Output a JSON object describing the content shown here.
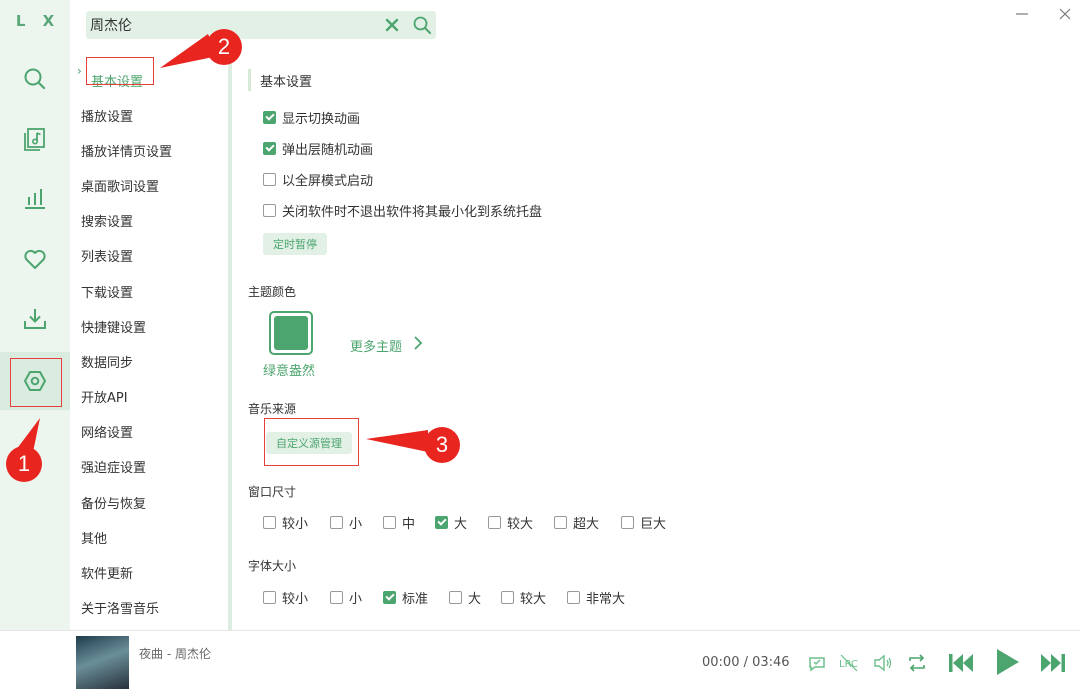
{
  "app": {
    "logo": "L X"
  },
  "search": {
    "value": "周杰伦",
    "placeholder": ""
  },
  "rail": {
    "items": [
      {
        "name": "search-icon",
        "active": false
      },
      {
        "name": "song-list-icon",
        "active": false
      },
      {
        "name": "leaderboard-icon",
        "active": false
      },
      {
        "name": "heart-icon",
        "active": false
      },
      {
        "name": "download-icon",
        "active": false
      },
      {
        "name": "settings-icon",
        "active": true
      }
    ]
  },
  "nav": {
    "items": [
      {
        "label": "基本设置",
        "active": true
      },
      {
        "label": "播放设置"
      },
      {
        "label": "播放详情页设置"
      },
      {
        "label": "桌面歌词设置"
      },
      {
        "label": "搜索设置"
      },
      {
        "label": "列表设置"
      },
      {
        "label": "下载设置"
      },
      {
        "label": "快捷键设置"
      },
      {
        "label": "数据同步"
      },
      {
        "label": "开放API"
      },
      {
        "label": "网络设置"
      },
      {
        "label": "强迫症设置"
      },
      {
        "label": "备份与恢复"
      },
      {
        "label": "其他"
      },
      {
        "label": "软件更新"
      },
      {
        "label": "关于洛雪音乐"
      }
    ]
  },
  "basic": {
    "title": "基本设置",
    "options": [
      {
        "label": "显示切换动画",
        "checked": true
      },
      {
        "label": "弹出层随机动画",
        "checked": true
      },
      {
        "label": "以全屏模式启动",
        "checked": false
      },
      {
        "label": "关闭软件时不退出软件将其最小化到系统托盘",
        "checked": false
      }
    ],
    "timer_button": "定时暂停"
  },
  "theme": {
    "title": "主题颜色",
    "current": "绿意盎然",
    "color": "#4ca56e",
    "more": "更多主题"
  },
  "source": {
    "title": "音乐来源",
    "manage_button": "自定义源管理"
  },
  "window_size": {
    "title": "窗口尺寸",
    "options": [
      {
        "label": "较小",
        "checked": false
      },
      {
        "label": "小",
        "checked": false
      },
      {
        "label": "中",
        "checked": false
      },
      {
        "label": "大",
        "checked": true
      },
      {
        "label": "较大",
        "checked": false
      },
      {
        "label": "超大",
        "checked": false
      },
      {
        "label": "巨大",
        "checked": false
      }
    ]
  },
  "font_size": {
    "title": "字体大小",
    "options": [
      {
        "label": "较小",
        "checked": false
      },
      {
        "label": "小",
        "checked": false
      },
      {
        "label": "标准",
        "checked": true
      },
      {
        "label": "大",
        "checked": false
      },
      {
        "label": "较大",
        "checked": false
      },
      {
        "label": "非常大",
        "checked": false
      }
    ]
  },
  "annotations": {
    "m1": "1",
    "m2": "2",
    "m3": "3"
  },
  "player": {
    "song": "夜曲 - 周杰伦",
    "time": "00:00 / 03:46"
  },
  "colors": {
    "accent": "#4ca56e",
    "annotation": "#e8261f"
  }
}
